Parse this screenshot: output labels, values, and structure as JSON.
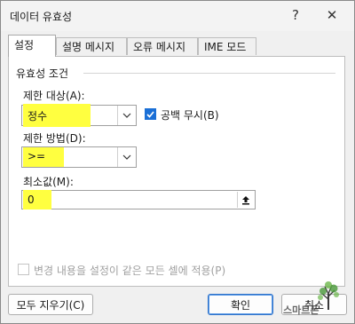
{
  "window": {
    "title": "데이터 유효성",
    "help_glyph": "?",
    "close_glyph": "✕"
  },
  "tabs": [
    {
      "label": "설정"
    },
    {
      "label": "설명 메시지"
    },
    {
      "label": "오류 메시지"
    },
    {
      "label": "IME 모드"
    }
  ],
  "criteria": {
    "group_title": "유효성 조건",
    "allow_label": "제한 대상(A):",
    "allow_value": "정수",
    "ignore_blank_label": "공백 무시(B)",
    "ignore_blank_checked": true,
    "data_label": "제한 방법(D):",
    "data_value": ">=",
    "minimum_label": "최소값(M):",
    "minimum_value": "0"
  },
  "apply_all_label": "변경 내용을 설정이 같은 모든 셀에 적용(P)",
  "buttons": {
    "clear_all": "모두 지우기(C)",
    "ok": "확인",
    "cancel": "취소"
  },
  "watermark": "스마트폰",
  "colors": {
    "highlight": "#ffff40",
    "checkbox_accent": "#1a6fd6",
    "default_button_border": "#2f73c9"
  },
  "icons": {
    "dropdown": "chevron-down-icon",
    "range_select": "collapse-arrow-icon",
    "watermark": "tree-logo-icon"
  }
}
